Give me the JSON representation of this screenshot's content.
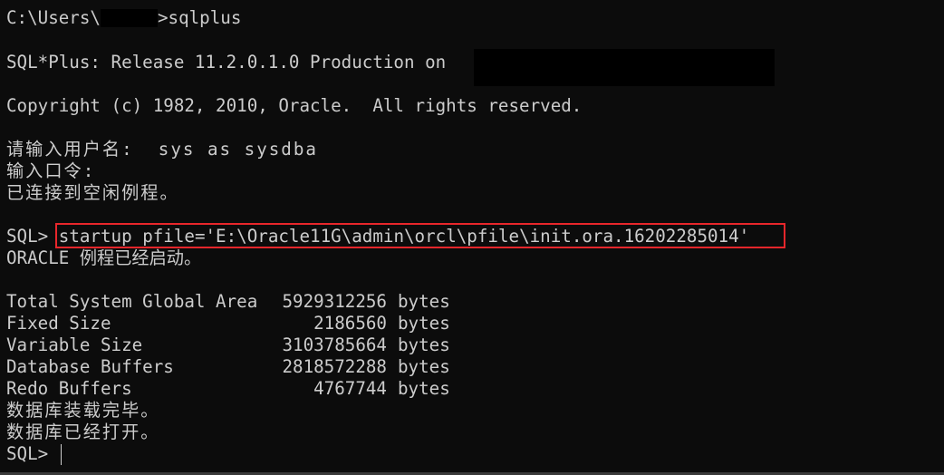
{
  "terminal": {
    "background": "#0c0c0c",
    "text_color": "#cccccc",
    "highlight_color": "#e8262b",
    "lines": {
      "cmd_prompt_prefix": "C:\\Users\\",
      "cmd_prompt_suffix": ">sqlplus",
      "release": "SQL*Plus: Release 11.2.0.1.0 Production on",
      "copyright": "Copyright (c) 1982, 2010, Oracle.  All rights reserved.",
      "username_prompt": "请输入用户名:  sys as sysdba",
      "password_prompt": "输入口令:",
      "connected_idle": "已连接到空闲例程。",
      "sql_prompt": "SQL>",
      "startup_command": "startup pfile='E:\\Oracle11G\\admin\\orcl\\pfile\\init.ora.16202285014'",
      "instance_started": "ORACLE 例程已经启动。",
      "mounted": "数据库装载完毕。",
      "opened": "数据库已经打开。",
      "final_prompt": "SQL>"
    },
    "sga": [
      {
        "label": "Total System Global Area",
        "value": "5929312256",
        "unit": "bytes"
      },
      {
        "label": "Fixed Size",
        "value": "2186560",
        "unit": "bytes"
      },
      {
        "label": "Variable Size",
        "value": "3103785664",
        "unit": "bytes"
      },
      {
        "label": "Database Buffers",
        "value": "2818572288",
        "unit": "bytes"
      },
      {
        "label": "Redo Buffers",
        "value": "4767744",
        "unit": "bytes"
      }
    ]
  }
}
